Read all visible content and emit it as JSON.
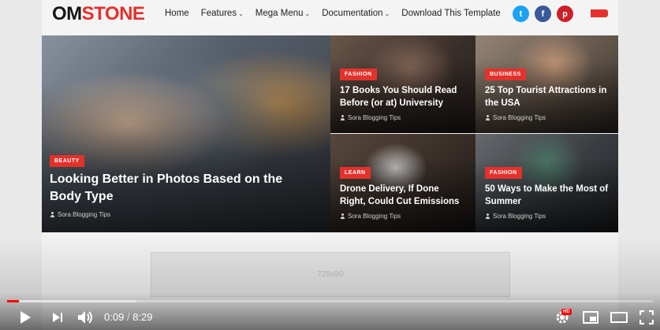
{
  "site": {
    "logo_part1": "OM",
    "logo_part2": "STONE",
    "nav": [
      {
        "label": "Home",
        "has_dropdown": false
      },
      {
        "label": "Features",
        "has_dropdown": true
      },
      {
        "label": "Mega Menu",
        "has_dropdown": true
      },
      {
        "label": "Documentation",
        "has_dropdown": true
      },
      {
        "label": "Download This Template",
        "has_dropdown": false
      }
    ],
    "social": [
      {
        "icon": "twitter-icon",
        "glyph": "t"
      },
      {
        "icon": "facebook-icon",
        "glyph": "f"
      },
      {
        "icon": "pinterest-icon",
        "glyph": "p"
      }
    ],
    "accent_color": "#e4312b"
  },
  "featured": {
    "big": {
      "badge": "BEAUTY",
      "title": "Looking Better in Photos Based on the Body Type",
      "author": "Sora Blogging Tips"
    },
    "small": [
      {
        "badge": "FASHION",
        "title": "17 Books You Should Read Before (or at) University",
        "author": "Sora Blogging Tips"
      },
      {
        "badge": "BUSINESS",
        "title": "25 Top Tourist Attractions in the USA",
        "author": "Sora Blogging Tips"
      },
      {
        "badge": "LEARN",
        "title": "Drone Delivery, If Done Right, Could Cut Emissions",
        "author": "Sora Blogging Tips"
      },
      {
        "badge": "FASHION",
        "title": "50 Ways to Make the Most of Summer",
        "author": "Sora Blogging Tips"
      }
    ]
  },
  "ad": {
    "label": "728x90"
  },
  "player": {
    "current_time": "0:09",
    "separator": "/",
    "duration": "8:29",
    "played_fraction": 0.018,
    "buffered_fraction": 0.2,
    "hd_badge": "HD",
    "progress_color": "#ff0000"
  }
}
